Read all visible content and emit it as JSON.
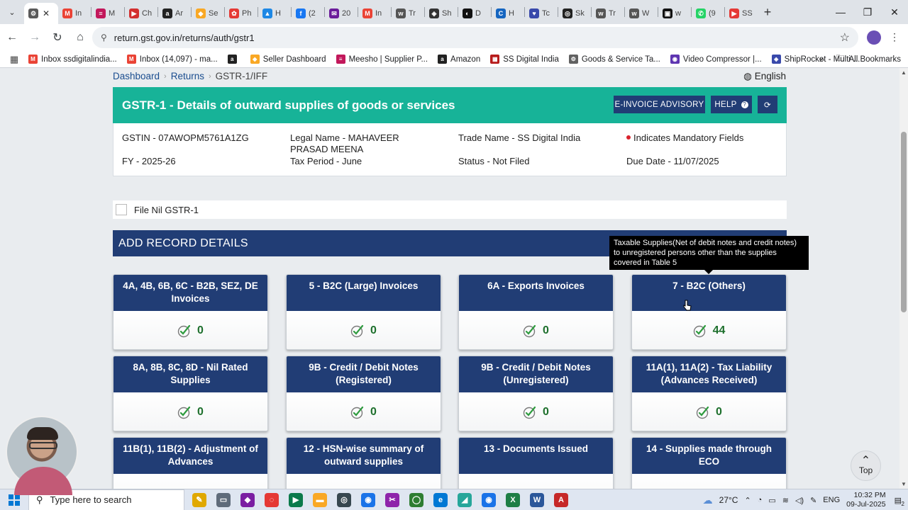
{
  "browser": {
    "tabs": [
      {
        "title": "",
        "fav_color": "#5a5a5a",
        "fav_text": "⚙",
        "active": true
      },
      {
        "title": "In",
        "fav_color": "#ea4335",
        "fav_text": "M"
      },
      {
        "title": "M",
        "fav_color": "#c2185b",
        "fav_text": "≡"
      },
      {
        "title": "Ch",
        "fav_color": "#d32f2f",
        "fav_text": "▶"
      },
      {
        "title": "Ar",
        "fav_color": "#222222",
        "fav_text": "a"
      },
      {
        "title": "Se",
        "fav_color": "#f9a825",
        "fav_text": "◆"
      },
      {
        "title": "Ph",
        "fav_color": "#e53935",
        "fav_text": "✿"
      },
      {
        "title": "H",
        "fav_color": "#1e88e5",
        "fav_text": "▲"
      },
      {
        "title": "(2",
        "fav_color": "#1877f2",
        "fav_text": "f"
      },
      {
        "title": "20",
        "fav_color": "#6a1b9a",
        "fav_text": "✉"
      },
      {
        "title": "In",
        "fav_color": "#ea4335",
        "fav_text": "M"
      },
      {
        "title": "Tr",
        "fav_color": "#555555",
        "fav_text": "w"
      },
      {
        "title": "Sh",
        "fav_color": "#333333",
        "fav_text": "◈"
      },
      {
        "title": "D",
        "fav_color": "#111111",
        "fav_text": "◐"
      },
      {
        "title": "H",
        "fav_color": "#1565c0",
        "fav_text": "C"
      },
      {
        "title": "Tc",
        "fav_color": "#3949ab",
        "fav_text": "♥"
      },
      {
        "title": "Sk",
        "fav_color": "#222222",
        "fav_text": "◎"
      },
      {
        "title": "Tr",
        "fav_color": "#555555",
        "fav_text": "w"
      },
      {
        "title": "W",
        "fav_color": "#555555",
        "fav_text": "w"
      },
      {
        "title": "w",
        "fav_color": "#111111",
        "fav_text": "▣"
      },
      {
        "title": "(9",
        "fav_color": "#25d366",
        "fav_text": "✆"
      },
      {
        "title": "SS",
        "fav_color": "#e53935",
        "fav_text": "▶"
      }
    ],
    "url": "return.gst.gov.in/returns/auth/gstr1",
    "bookmarks": [
      {
        "label": "Inbox ssdigitalindia...",
        "color": "#ea4335",
        "icon": "M"
      },
      {
        "label": "Inbox (14,097) - ma...",
        "color": "#ea4335",
        "icon": "M"
      },
      {
        "label": "",
        "color": "#222222",
        "icon": "a"
      },
      {
        "label": "Seller Dashboard",
        "color": "#f9a825",
        "icon": "◆"
      },
      {
        "label": "Meesho | Supplier P...",
        "color": "#c2185b",
        "icon": "≡"
      },
      {
        "label": "Amazon",
        "color": "#222222",
        "icon": "a"
      },
      {
        "label": "SS Digital India",
        "color": "#b71c1c",
        "icon": "▦"
      },
      {
        "label": "Goods & Service Ta...",
        "color": "#616161",
        "icon": "⚙"
      },
      {
        "label": "Video Compressor |...",
        "color": "#5e35b1",
        "icon": "◉"
      },
      {
        "label": "ShipRocket - Multi-...",
        "color": "#3949ab",
        "icon": "◈"
      }
    ],
    "all_bookmarks": "All Bookmarks"
  },
  "page": {
    "breadcrumb": {
      "dashboard": "Dashboard",
      "returns": "Returns",
      "current": "GSTR-1/IFF"
    },
    "language": "English",
    "title": "GSTR-1 - Details of outward supplies of goods or services",
    "buttons": {
      "einvoice": "E-INVOICE ADVISORY",
      "help": "HELP"
    },
    "info": {
      "gstin": "GSTIN - 07AWOPM5761A1ZG",
      "legal_name": "Legal Name - MAHAVEER PRASAD MEENA",
      "trade_name": "Trade Name - SS Digital India",
      "mandatory": "Indicates Mandatory Fields",
      "fy": "FY - 2025-26",
      "tax_period": "Tax Period - June",
      "status": "Status - Not Filed",
      "due_date": "Due Date - 11/07/2025"
    },
    "nil_label": "File Nil GSTR-1",
    "add_record": "ADD RECORD DETAILS",
    "tooltip": "Taxable Supplies(Net of debit notes and credit notes) to unregistered persons other than the supplies covered in Table 5",
    "tiles": [
      {
        "title": "4A, 4B, 6B, 6C - B2B, SEZ, DE Invoices",
        "count": "0"
      },
      {
        "title": "5 - B2C (Large) Invoices",
        "count": "0"
      },
      {
        "title": "6A - Exports Invoices",
        "count": "0"
      },
      {
        "title": "7 - B2C (Others)",
        "count": "44"
      },
      {
        "title": "8A, 8B, 8C, 8D - Nil Rated Supplies",
        "count": "0"
      },
      {
        "title": "9B - Credit / Debit Notes (Registered)",
        "count": "0"
      },
      {
        "title": "9B - Credit / Debit Notes (Unregistered)",
        "count": "0"
      },
      {
        "title": "11A(1), 11A(2) - Tax Liability (Advances Received)",
        "count": "0"
      },
      {
        "title": "11B(1), 11B(2) - Adjustment of Advances",
        "count": ""
      },
      {
        "title": "12 - HSN-wise summary of outward supplies",
        "count": ""
      },
      {
        "title": "13 - Documents Issued",
        "count": ""
      },
      {
        "title": "14 - Supplies made through ECO",
        "count": ""
      }
    ],
    "top_button": "Top"
  },
  "taskbar": {
    "search_placeholder": "Type here to search",
    "apps": [
      {
        "color": "#e0a800",
        "icon": "✎"
      },
      {
        "color": "#5f6b7a",
        "icon": "▭"
      },
      {
        "color": "#7b1fa2",
        "icon": "◆"
      },
      {
        "color": "#e53935",
        "icon": "◌"
      },
      {
        "color": "#0b7a4b",
        "icon": "▶"
      },
      {
        "color": "#f9a825",
        "icon": "▬"
      },
      {
        "color": "#37474f",
        "icon": "◎"
      },
      {
        "color": "#1a73e8",
        "icon": "◉"
      },
      {
        "color": "#8e24aa",
        "icon": "✂"
      },
      {
        "color": "#2e7d32",
        "icon": "◯"
      },
      {
        "color": "#0078d4",
        "icon": "e"
      },
      {
        "color": "#26a69a",
        "icon": "◢"
      },
      {
        "color": "#1a73e8",
        "icon": "◉"
      },
      {
        "color": "#1e7e45",
        "icon": "X"
      },
      {
        "color": "#2b579a",
        "icon": "W"
      },
      {
        "color": "#c62828",
        "icon": "A"
      }
    ],
    "weather": "27°C",
    "language": "ENG",
    "time": "10:32 PM",
    "date": "09-Jul-2025",
    "notifications": "2"
  },
  "colors": {
    "teal": "#17b398",
    "navy": "#213d75",
    "count_green": "#1d6f2c"
  }
}
